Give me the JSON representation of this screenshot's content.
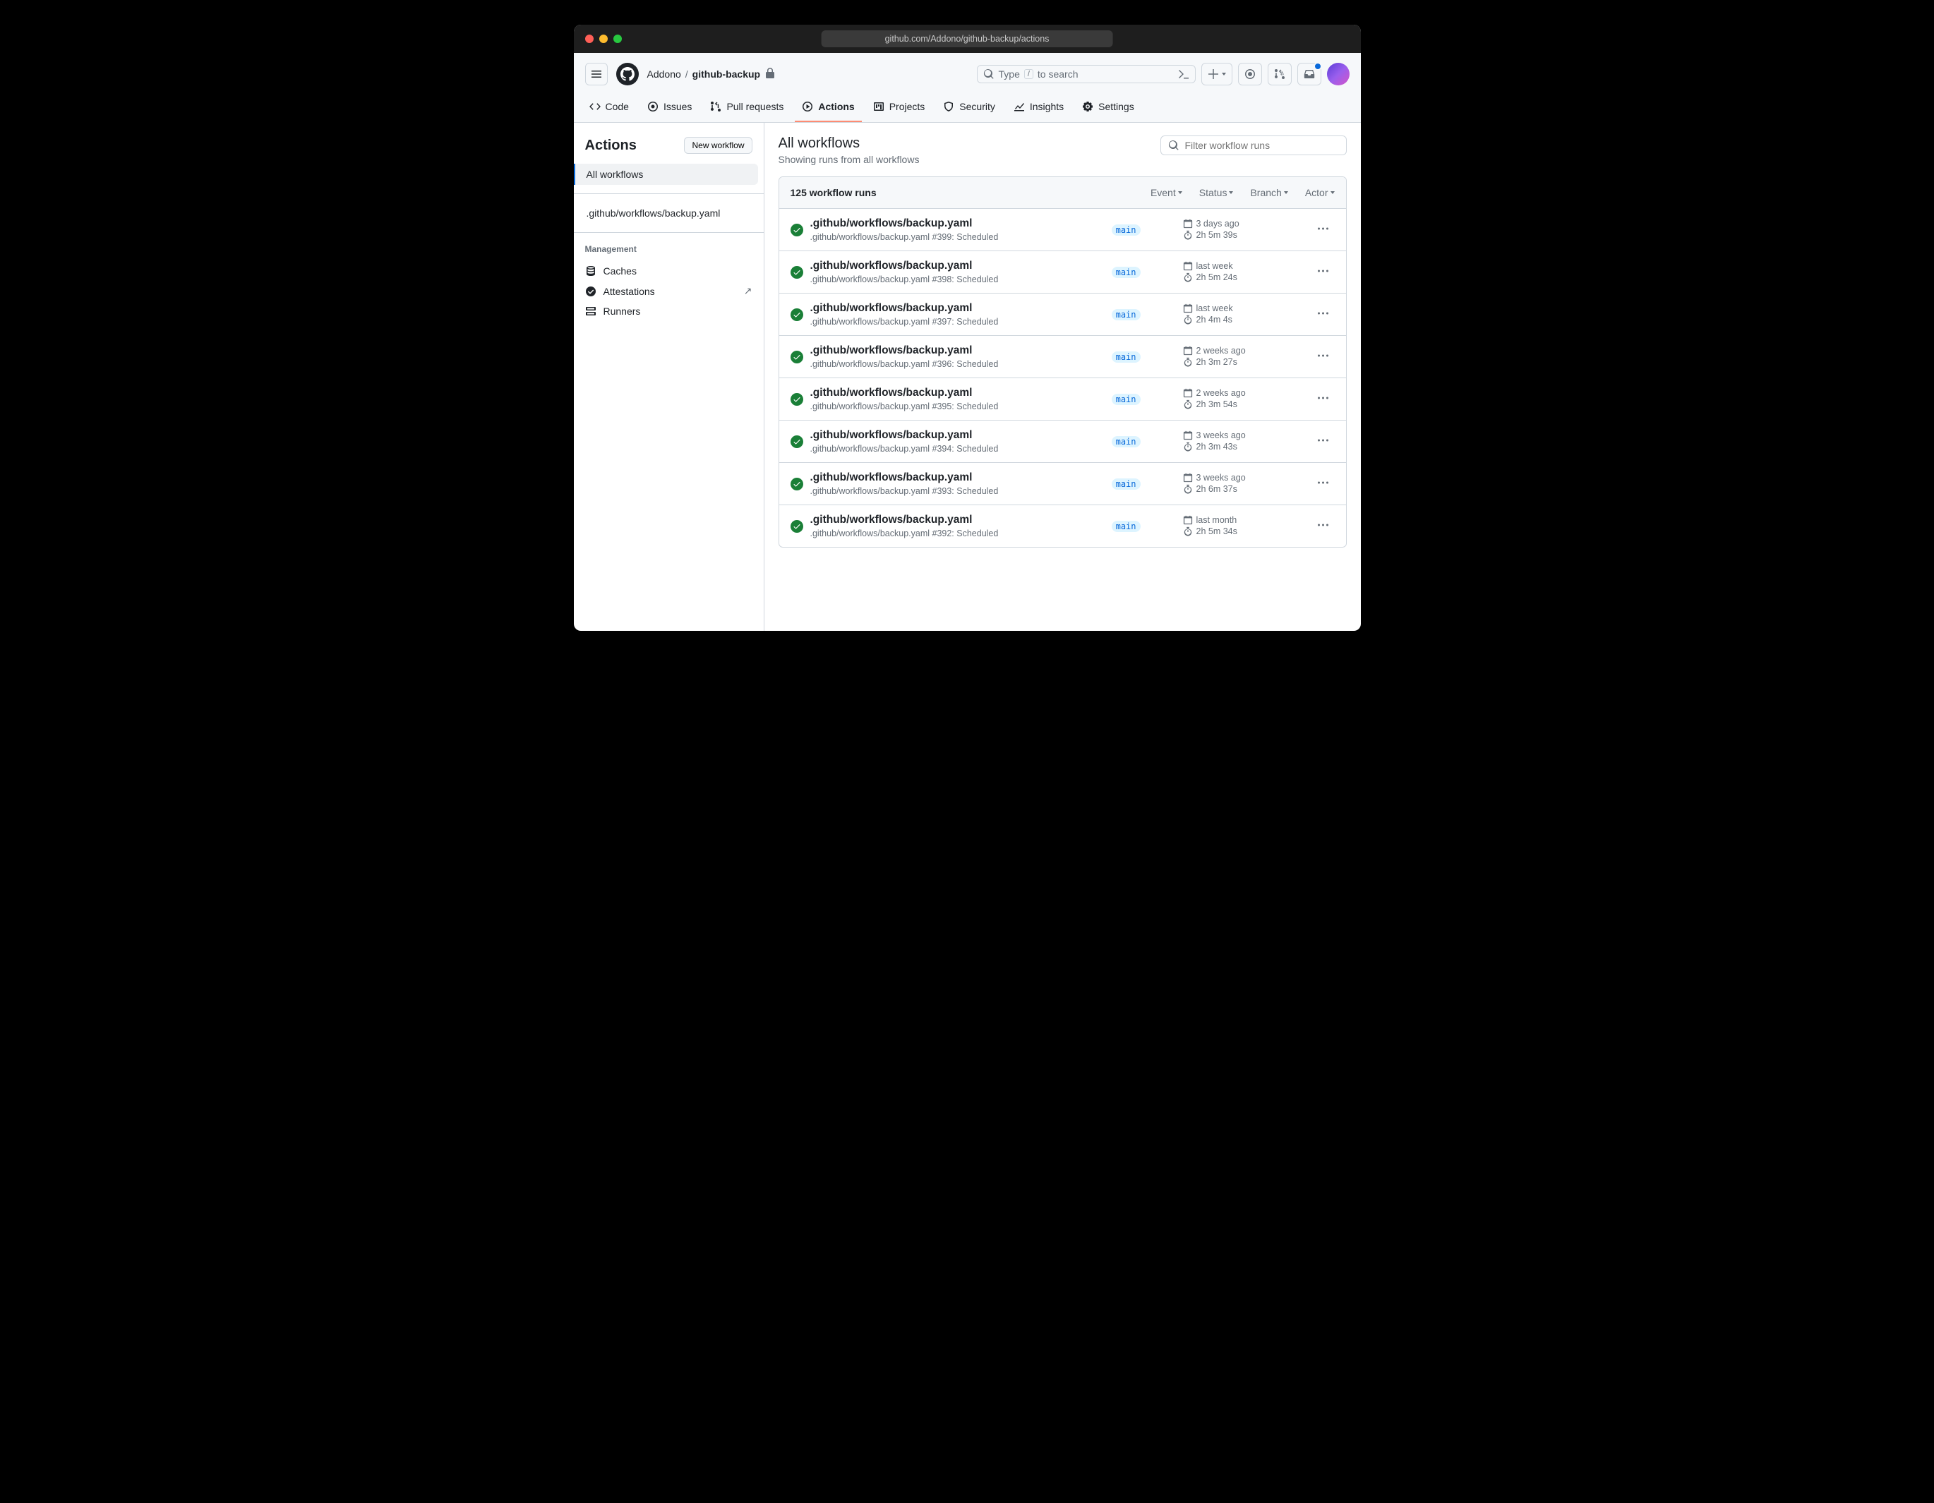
{
  "url": "github.com/Addono/github-backup/actions",
  "breadcrumb": {
    "owner": "Addono",
    "repo": "github-backup"
  },
  "search": {
    "prefix": "Type",
    "key": "/",
    "suffix": "to search"
  },
  "tabs": {
    "code": "Code",
    "issues": "Issues",
    "pull_requests": "Pull requests",
    "actions": "Actions",
    "projects": "Projects",
    "security": "Security",
    "insights": "Insights",
    "settings": "Settings"
  },
  "sidebar": {
    "title": "Actions",
    "new_workflow": "New workflow",
    "all_workflows": "All workflows",
    "workflow_item": ".github/workflows/backup.yaml",
    "management_label": "Management",
    "caches": "Caches",
    "attestations": "Attestations",
    "runners": "Runners"
  },
  "content": {
    "title": "All workflows",
    "subtitle": "Showing runs from all workflows",
    "filter_placeholder": "Filter workflow runs",
    "count": "125 workflow runs",
    "filter_event": "Event",
    "filter_status": "Status",
    "filter_branch": "Branch",
    "filter_actor": "Actor"
  },
  "runs": [
    {
      "title": ".github/workflows/backup.yaml",
      "workflow": ".github/workflows/backup.yaml",
      "num": "#399",
      "trigger": ": Scheduled",
      "branch": "main",
      "time": "3 days ago",
      "duration": "2h 5m 39s"
    },
    {
      "title": ".github/workflows/backup.yaml",
      "workflow": ".github/workflows/backup.yaml",
      "num": "#398",
      "trigger": ": Scheduled",
      "branch": "main",
      "time": "last week",
      "duration": "2h 5m 24s"
    },
    {
      "title": ".github/workflows/backup.yaml",
      "workflow": ".github/workflows/backup.yaml",
      "num": "#397",
      "trigger": ": Scheduled",
      "branch": "main",
      "time": "last week",
      "duration": "2h 4m 4s"
    },
    {
      "title": ".github/workflows/backup.yaml",
      "workflow": ".github/workflows/backup.yaml",
      "num": "#396",
      "trigger": ": Scheduled",
      "branch": "main",
      "time": "2 weeks ago",
      "duration": "2h 3m 27s"
    },
    {
      "title": ".github/workflows/backup.yaml",
      "workflow": ".github/workflows/backup.yaml",
      "num": "#395",
      "trigger": ": Scheduled",
      "branch": "main",
      "time": "2 weeks ago",
      "duration": "2h 3m 54s"
    },
    {
      "title": ".github/workflows/backup.yaml",
      "workflow": ".github/workflows/backup.yaml",
      "num": "#394",
      "trigger": ": Scheduled",
      "branch": "main",
      "time": "3 weeks ago",
      "duration": "2h 3m 43s"
    },
    {
      "title": ".github/workflows/backup.yaml",
      "workflow": ".github/workflows/backup.yaml",
      "num": "#393",
      "trigger": ": Scheduled",
      "branch": "main",
      "time": "3 weeks ago",
      "duration": "2h 6m 37s"
    },
    {
      "title": ".github/workflows/backup.yaml",
      "workflow": ".github/workflows/backup.yaml",
      "num": "#392",
      "trigger": ": Scheduled",
      "branch": "main",
      "time": "last month",
      "duration": "2h 5m 34s"
    }
  ]
}
